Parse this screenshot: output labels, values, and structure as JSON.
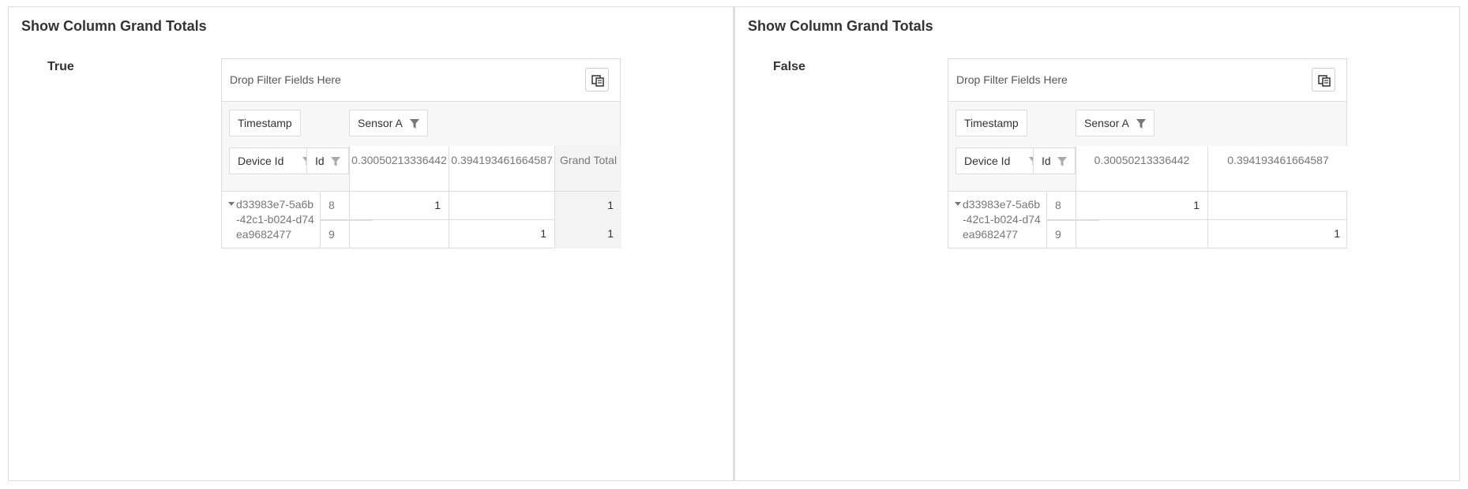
{
  "panels": [
    {
      "title": "Show Column Grand Totals",
      "option": "True",
      "pivot": {
        "filter_placeholder": "Drop Filter Fields Here",
        "fields": {
          "timestamp": "Timestamp",
          "sensor": "Sensor A",
          "device": "Device Id",
          "id": "Id"
        },
        "columns": [
          "0.30050213336442",
          "0.394193461664587"
        ],
        "grand_total_label": "Grand Total",
        "row_group": "d33983e7-5a6b-42c1-b024-d74ea9682477",
        "rows": [
          {
            "id": "8",
            "values": [
              "1",
              ""
            ],
            "grand_total": "1"
          },
          {
            "id": "9",
            "values": [
              "",
              "1"
            ],
            "grand_total": "1"
          }
        ]
      }
    },
    {
      "title": "Show Column Grand Totals",
      "option": "False",
      "pivot": {
        "filter_placeholder": "Drop Filter Fields Here",
        "fields": {
          "timestamp": "Timestamp",
          "sensor": "Sensor A",
          "device": "Device Id",
          "id": "Id"
        },
        "columns": [
          "0.30050213336442",
          "0.394193461664587"
        ],
        "row_group": "d33983e7-5a6b-42c1-b024-d74ea9682477",
        "rows": [
          {
            "id": "8",
            "values": [
              "1",
              ""
            ]
          },
          {
            "id": "9",
            "values": [
              "",
              "1"
            ]
          }
        ]
      }
    }
  ],
  "icons": {
    "field_chooser": "field-chooser-icon",
    "filter": "funnel-icon",
    "expand": "expand-triangle-icon"
  }
}
